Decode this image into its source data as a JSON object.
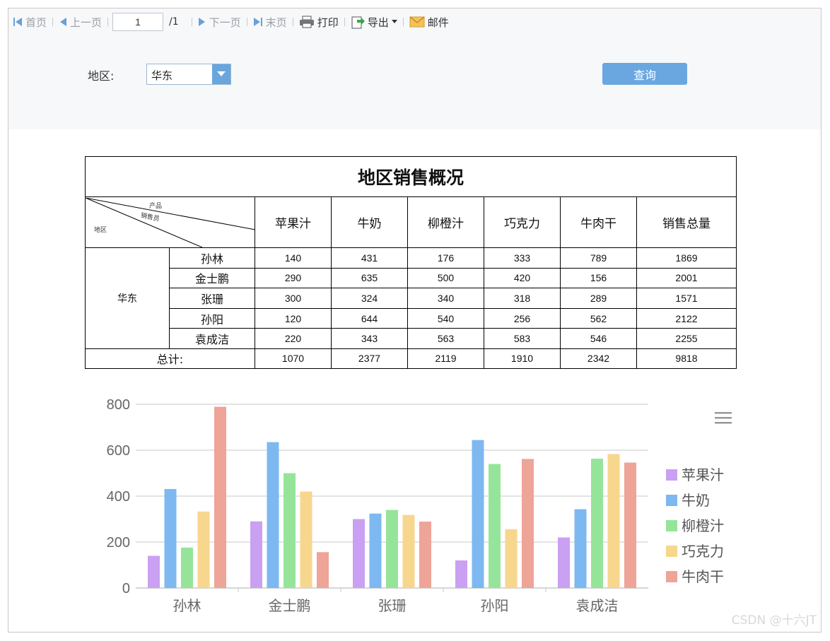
{
  "toolbar": {
    "first": "首页",
    "prev": "上一页",
    "page_value": "1",
    "page_total": "/1",
    "next": "下一页",
    "last": "末页",
    "print": "打印",
    "export": "导出",
    "mail": "邮件"
  },
  "params": {
    "region_label": "地区:",
    "region_value": "华东",
    "query_label": "查询"
  },
  "report": {
    "title": "地区销售概况",
    "corner": {
      "product": "产品",
      "seller": "销售员",
      "region": "地区"
    },
    "columns": [
      "苹果汁",
      "牛奶",
      "柳橙汁",
      "巧克力",
      "牛肉干",
      "销售总量"
    ],
    "region": "华东",
    "rows": [
      {
        "name": "孙林",
        "values": [
          "140",
          "431",
          "176",
          "333",
          "789",
          "1869"
        ]
      },
      {
        "name": "金士鹏",
        "values": [
          "290",
          "635",
          "500",
          "420",
          "156",
          "2001"
        ]
      },
      {
        "name": "张珊",
        "values": [
          "300",
          "324",
          "340",
          "318",
          "289",
          "1571"
        ]
      },
      {
        "name": "孙阳",
        "values": [
          "120",
          "644",
          "540",
          "256",
          "562",
          "2122"
        ]
      },
      {
        "name": "袁成洁",
        "values": [
          "220",
          "343",
          "563",
          "583",
          "546",
          "2255"
        ]
      }
    ],
    "total_label": "总计:",
    "totals": [
      "1070",
      "2377",
      "2119",
      "1910",
      "2342",
      "9818"
    ]
  },
  "chart_data": {
    "type": "bar",
    "categories": [
      "孙林",
      "金士鹏",
      "张珊",
      "孙阳",
      "袁成洁"
    ],
    "series": [
      {
        "name": "苹果汁",
        "color": "#c9a0f2",
        "values": [
          140,
          290,
          300,
          120,
          220
        ]
      },
      {
        "name": "牛奶",
        "color": "#7db8f0",
        "values": [
          431,
          635,
          324,
          644,
          343
        ]
      },
      {
        "name": "柳橙汁",
        "color": "#96e49a",
        "values": [
          176,
          500,
          340,
          540,
          563
        ]
      },
      {
        "name": "巧克力",
        "color": "#f7d68d",
        "values": [
          333,
          420,
          318,
          256,
          583
        ]
      },
      {
        "name": "牛肉干",
        "color": "#eea497",
        "values": [
          789,
          156,
          289,
          562,
          546
        ]
      }
    ],
    "yticks": [
      0,
      200,
      400,
      600,
      800
    ],
    "ylim": [
      0,
      800
    ],
    "grid": true,
    "legend": "right",
    "menu_icon": "hamburger-icon"
  },
  "watermark": "CSDN @十六JT"
}
